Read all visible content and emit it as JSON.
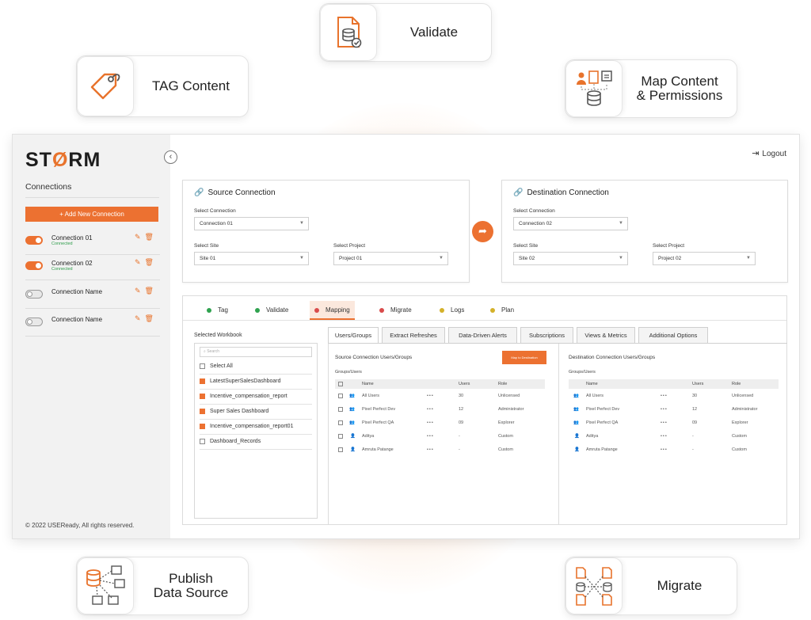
{
  "features": {
    "validate": "Validate",
    "tag": "TAG Content",
    "map_line1": "Map Content",
    "map_line2": "& Permissions",
    "publish_line1": "Publish",
    "publish_line2": "Data Source",
    "migrate": "Migrate"
  },
  "colors": {
    "accent": "#ec7131",
    "connected": "#2e9d4b",
    "green_dot": "#2fa24f",
    "red_dot": "#d94b4b",
    "yellow_dot": "#d4b12a"
  },
  "sidebar": {
    "logo_pre": "ST",
    "logo_o": "Ø",
    "logo_post": "RM",
    "title": "Connections",
    "add_button": "+ Add New Connection",
    "connections": [
      {
        "name": "Connection 01",
        "status": "Connected",
        "on": true
      },
      {
        "name": "Connection 02",
        "status": "Connected",
        "on": true
      },
      {
        "name": "Connection Name",
        "status": "",
        "on": false
      },
      {
        "name": "Connection Name",
        "status": "",
        "on": false
      }
    ],
    "copyright": "© 2022 USEReady, All rights reserved."
  },
  "header": {
    "logout": "Logout"
  },
  "source": {
    "title": "Source Connection",
    "connection_label": "Select Connection",
    "connection_value": "Connection 01",
    "site_label": "Select Site",
    "site_value": "Site 01",
    "project_label": "Select Project",
    "project_value": "Project 01"
  },
  "destination": {
    "title": "Destination Connection",
    "connection_label": "Select Connection",
    "connection_value": "Connection 02",
    "site_label": "Select Site",
    "site_value": "Site 02",
    "project_label": "Select Project",
    "project_value": "Project 02"
  },
  "workflow_tabs": [
    "Tag",
    "Validate",
    "Mapping",
    "Migrate",
    "Logs",
    "Plan"
  ],
  "workbooks": {
    "title": "Selected Workbook",
    "search_placeholder": "Search",
    "items": [
      {
        "label": "Select All",
        "checked": false
      },
      {
        "label": "LatestSuperSalesDashboard",
        "checked": true
      },
      {
        "label": "Incentive_compensation_report",
        "checked": true
      },
      {
        "label": "Super Sales Dashboard",
        "checked": true
      },
      {
        "label": "Incentive_compensation_report01",
        "checked": true
      },
      {
        "label": "Dashboard_Records",
        "checked": false
      }
    ]
  },
  "content_tabs": [
    "Users/Groups",
    "Extract Refreshes",
    "Data-Driven Alerts",
    "Subscriptions",
    "Views & Metrics",
    "Additional Options"
  ],
  "source_users": {
    "title": "Source Connection Users/Groups",
    "map_button": "Map to Destination",
    "subtitle": "Groups/Users",
    "columns": [
      "Name",
      "Users",
      "Role"
    ],
    "rows": [
      {
        "name": "All Users",
        "users": "30",
        "role": "Unlicensed",
        "kind": "group"
      },
      {
        "name": "Pixel Perfect Dev",
        "users": "12",
        "role": "Administrator",
        "kind": "group"
      },
      {
        "name": "Pixel Perfect QA",
        "users": "09",
        "role": "Explorer",
        "kind": "group"
      },
      {
        "name": "Aditya",
        "users": "-",
        "role": "Custom",
        "kind": "user"
      },
      {
        "name": "Amruta Patange",
        "users": "-",
        "role": "Custom",
        "kind": "user"
      }
    ]
  },
  "dest_users": {
    "title": "Destination Connection Users/Groups",
    "subtitle": "Groups/Users",
    "columns": [
      "Name",
      "Users",
      "Role"
    ],
    "rows": [
      {
        "name": "All Users",
        "users": "30",
        "role": "Unlicensed",
        "kind": "group"
      },
      {
        "name": "Pixel Perfect Dev",
        "users": "12",
        "role": "Administrator",
        "kind": "group"
      },
      {
        "name": "Pixel Perfect QA",
        "users": "09",
        "role": "Explorer",
        "kind": "group"
      },
      {
        "name": "Aditya",
        "users": "-",
        "role": "Custom",
        "kind": "user"
      },
      {
        "name": "Amruta Patange",
        "users": "-",
        "role": "Custom",
        "kind": "user"
      }
    ]
  }
}
